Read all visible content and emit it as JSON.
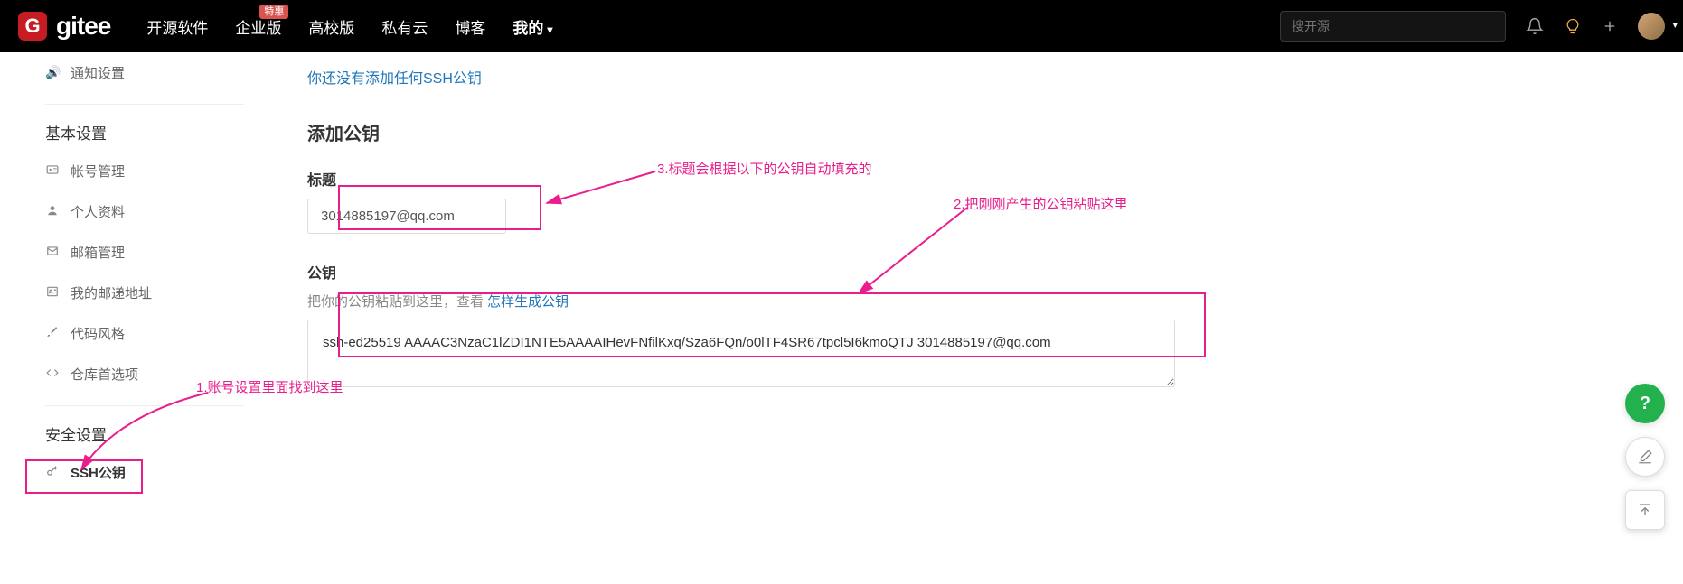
{
  "navbar": {
    "logo_text": "gitee",
    "logo_letter": "G",
    "links": {
      "opensource": "开源软件",
      "enterprise": "企业版",
      "enterprise_badge": "特惠",
      "campus": "高校版",
      "private_cloud": "私有云",
      "blog": "博客",
      "my": "我的"
    },
    "search_placeholder": "搜开源"
  },
  "sidebar": {
    "item_notification": "通知设置",
    "section_basic": "基本设置",
    "item_account": "帐号管理",
    "item_profile": "个人资料",
    "item_email": "邮箱管理",
    "item_address": "我的邮递地址",
    "item_code_style": "代码风格",
    "item_repo_pref": "仓库首选项",
    "section_security": "安全设置",
    "item_ssh": "SSH公钥"
  },
  "content": {
    "notice": "你还没有添加任何SSH公钥",
    "form_title": "添加公钥",
    "title_label": "标题",
    "title_value": "3014885197@qq.com",
    "key_label": "公钥",
    "key_help_prefix": "把你的公钥粘贴到这里，查看 ",
    "key_help_link": "怎样生成公钥",
    "key_value": "ssh-ed25519 AAAAC3NzaC1lZDI1NTE5AAAAIHevFNfilKxq/Sza6FQn/o0lTF4SR67tpcl5I6kmoQTJ 3014885197@qq.com"
  },
  "annotations": {
    "a1": "1.账号设置里面找到这里",
    "a2": "2.把刚刚产生的公钥粘贴这里",
    "a3": "3.标题会根据以下的公钥自动填充的"
  },
  "float": {
    "help": "?"
  }
}
